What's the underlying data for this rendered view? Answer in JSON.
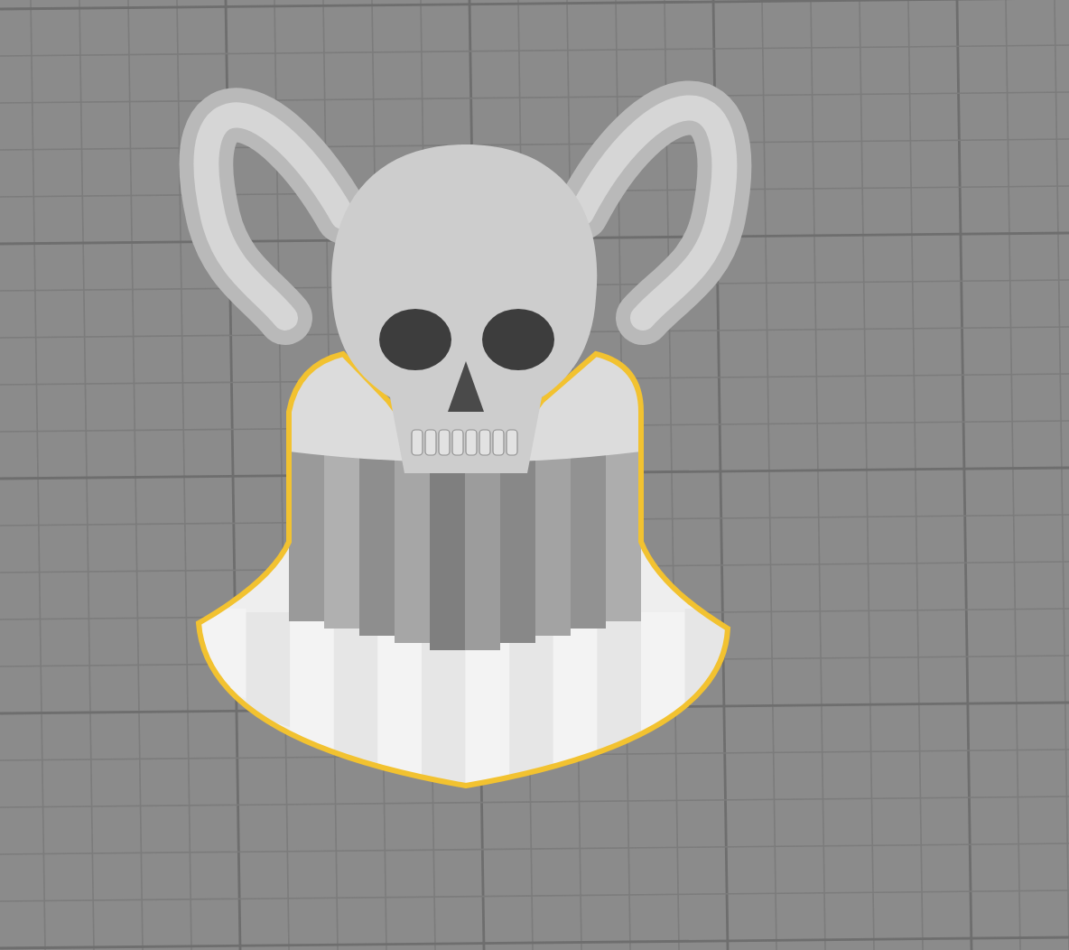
{
  "viewport": {
    "objects": [
      {
        "kind": "skull",
        "selected": false
      },
      {
        "kind": "pedestal",
        "selected": true
      }
    ]
  }
}
